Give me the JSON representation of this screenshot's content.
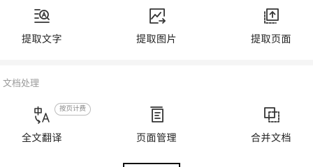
{
  "top_row": {
    "items": [
      {
        "label": "提取文字",
        "icon": "text-recognition-icon"
      },
      {
        "label": "提取图片",
        "icon": "image-export-icon"
      },
      {
        "label": "提取页面",
        "icon": "page-export-icon"
      }
    ]
  },
  "doc_section": {
    "title": "文档处理",
    "items": [
      {
        "label": "全文翻译",
        "icon": "translate-icon",
        "badge": "按页计费"
      },
      {
        "label": "页面管理",
        "icon": "page-manage-icon"
      },
      {
        "label": "合并文档",
        "icon": "merge-document-icon"
      }
    ]
  },
  "colors": {
    "text": "#222222",
    "muted": "#9a9a9a",
    "divider": "#f5f5f5",
    "icon_stroke": "#333333"
  }
}
